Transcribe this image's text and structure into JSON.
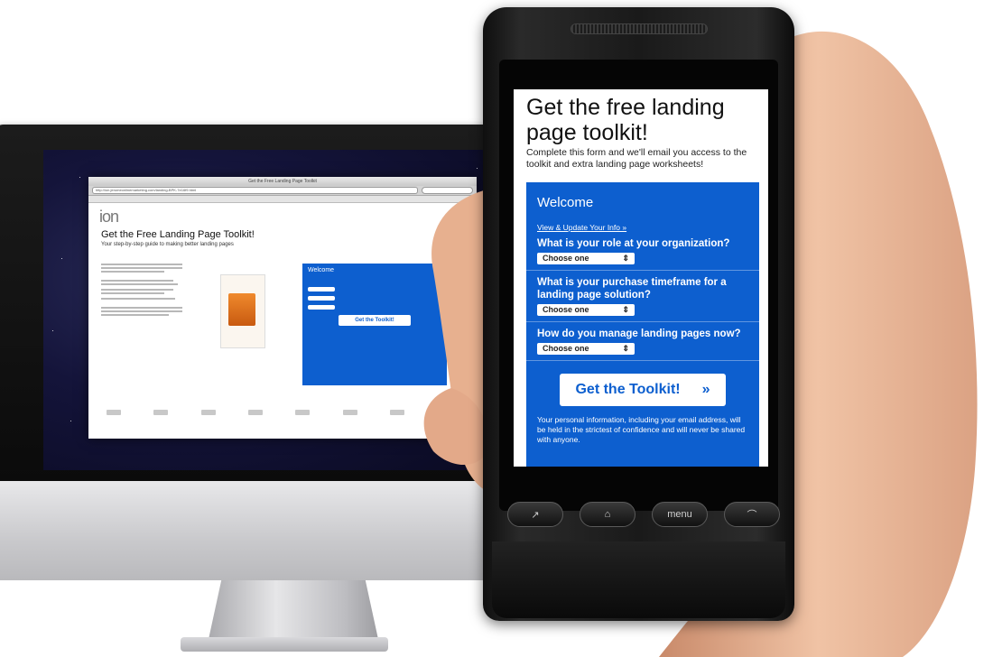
{
  "desktop": {
    "browser_title": "Get the Free Landing Page Toolkit",
    "url": "http://ion.jeromeonlinemarketing.com/landing-BPK-7e16f9.html",
    "logo": "ion",
    "page_title": "Get the Free Landing Page Toolkit!",
    "page_subtitle": "Your step-by-step guide to making better landing pages",
    "form_welcome": "Welcome",
    "form_button": "Get the Toolkit!"
  },
  "phone": {
    "title": "Get the free landing page toolkit!",
    "description": "Complete this form and we'll email you access to the toolkit and extra landing page worksheets!",
    "form": {
      "welcome": "Welcome",
      "link": "View & Update Your Info »",
      "questions": [
        {
          "label": "What is your role at your organization?",
          "select": "Choose one"
        },
        {
          "label": "What is your purchase timeframe for a landing page solution?",
          "select": "Choose one"
        },
        {
          "label": "How do you manage landing pages now?",
          "select": "Choose one"
        }
      ],
      "submit_label": "Get the Toolkit!",
      "submit_arrow": "»",
      "privacy": "Your personal information, including your email address, will be held in the strictest of confidence and will never be shared with anyone."
    },
    "buttons": {
      "call": "↗",
      "home": "⌂",
      "menu": "menu",
      "end": "⌒"
    }
  },
  "colors": {
    "form_blue": "#0d5fcf",
    "skin": "#e9b89a"
  }
}
